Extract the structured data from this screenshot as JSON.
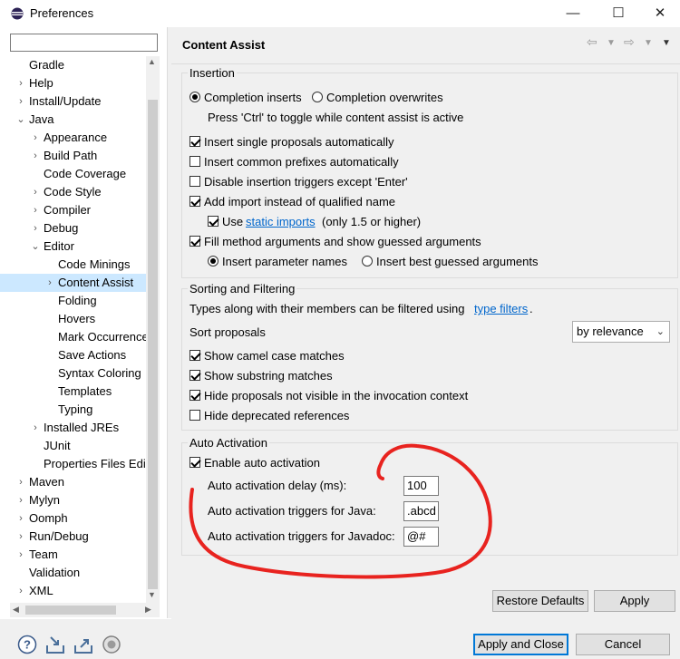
{
  "window": {
    "title": "Preferences",
    "minimize": "—",
    "maximize": "☐",
    "close": "✕"
  },
  "filter": {
    "value": ""
  },
  "tree": {
    "items": [
      {
        "label": "Gradle",
        "level": 0,
        "chevron": ""
      },
      {
        "label": "Help",
        "level": 0,
        "chevron": "›"
      },
      {
        "label": "Install/Update",
        "level": 0,
        "chevron": "›"
      },
      {
        "label": "Java",
        "level": 0,
        "chevron": "⌄"
      },
      {
        "label": "Appearance",
        "level": 1,
        "chevron": "›"
      },
      {
        "label": "Build Path",
        "level": 1,
        "chevron": "›"
      },
      {
        "label": "Code Coverage",
        "level": 1,
        "chevron": ""
      },
      {
        "label": "Code Style",
        "level": 1,
        "chevron": "›"
      },
      {
        "label": "Compiler",
        "level": 1,
        "chevron": "›"
      },
      {
        "label": "Debug",
        "level": 1,
        "chevron": "›"
      },
      {
        "label": "Editor",
        "level": 1,
        "chevron": "⌄"
      },
      {
        "label": "Code Minings",
        "level": 2,
        "chevron": ""
      },
      {
        "label": "Content Assist",
        "level": 2,
        "chevron": "›",
        "selected": true
      },
      {
        "label": "Folding",
        "level": 2,
        "chevron": ""
      },
      {
        "label": "Hovers",
        "level": 2,
        "chevron": ""
      },
      {
        "label": "Mark Occurrence",
        "level": 2,
        "chevron": ""
      },
      {
        "label": "Save Actions",
        "level": 2,
        "chevron": ""
      },
      {
        "label": "Syntax Coloring",
        "level": 2,
        "chevron": ""
      },
      {
        "label": "Templates",
        "level": 2,
        "chevron": ""
      },
      {
        "label": "Typing",
        "level": 2,
        "chevron": ""
      },
      {
        "label": "Installed JREs",
        "level": 1,
        "chevron": "›"
      },
      {
        "label": "JUnit",
        "level": 1,
        "chevron": ""
      },
      {
        "label": "Properties Files Edi",
        "level": 1,
        "chevron": ""
      },
      {
        "label": "Maven",
        "level": 0,
        "chevron": "›"
      },
      {
        "label": "Mylyn",
        "level": 0,
        "chevron": "›"
      },
      {
        "label": "Oomph",
        "level": 0,
        "chevron": "›"
      },
      {
        "label": "Run/Debug",
        "level": 0,
        "chevron": "›"
      },
      {
        "label": "Team",
        "level": 0,
        "chevron": "›"
      },
      {
        "label": "Validation",
        "level": 0,
        "chevron": ""
      },
      {
        "label": "XML",
        "level": 0,
        "chevron": "›"
      }
    ]
  },
  "page": {
    "title": "Content Assist"
  },
  "insertion": {
    "title": "Insertion",
    "completion_inserts": "Completion inserts",
    "completion_overwrites": "Completion overwrites",
    "toggle_hint": "Press 'Ctrl' to toggle while content assist is active",
    "insert_single": "Insert single proposals automatically",
    "insert_common": "Insert common prefixes automatically",
    "disable_triggers": "Disable insertion triggers except 'Enter'",
    "add_import": "Add import instead of qualified name",
    "use_label": "Use",
    "static_imports_link": "static imports",
    "static_imports_suffix": "(only 1.5 or higher)",
    "fill_args": "Fill method arguments and show guessed arguments",
    "insert_param_names": "Insert parameter names",
    "insert_best_guessed": "Insert best guessed arguments"
  },
  "sorting": {
    "title": "Sorting and Filtering",
    "types_text": "Types along with their members can be filtered using",
    "type_filters_link": "type filters",
    "period": ".",
    "sort_label": "Sort proposals",
    "sort_value": "by relevance",
    "camel": "Show camel case matches",
    "substring": "Show substring matches",
    "hide_not_visible": "Hide proposals not visible in the invocation context",
    "hide_deprecated": "Hide deprecated references"
  },
  "auto": {
    "title": "Auto Activation",
    "enable": "Enable auto activation",
    "delay_label": "Auto activation delay (ms):",
    "delay_value": "100",
    "java_label": "Auto activation triggers for Java:",
    "java_value": ".abcd",
    "javadoc_label": "Auto activation triggers for Javadoc:",
    "javadoc_value": "@#"
  },
  "buttons": {
    "restore_defaults": "Restore Defaults",
    "apply": "Apply",
    "apply_and_close": "Apply and Close",
    "cancel": "Cancel"
  },
  "colors": {
    "annotation_red": "#e8231f",
    "selection": "#cce8ff",
    "accent": "#0078d7"
  }
}
